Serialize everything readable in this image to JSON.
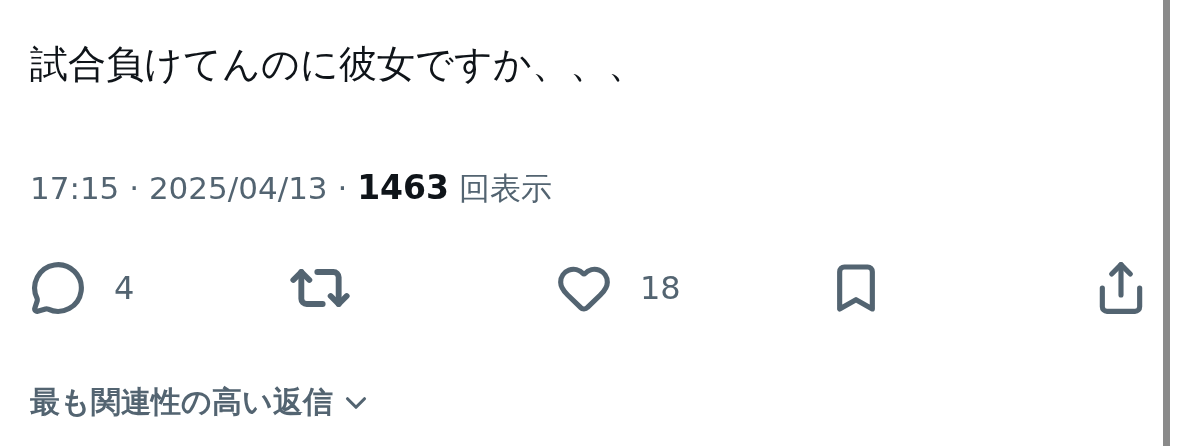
{
  "post": {
    "text": "試合負けてんのに彼女ですか、、、",
    "meta": "17:15 · 2025/04/13 · **1463** 回表示",
    "actions": [
      {
        "kind": "reply",
        "count": "4"
      },
      {
        "kind": "repost"
      },
      {
        "kind": "like",
        "count": "18"
      },
      {
        "kind": "bookmark"
      },
      {
        "kind": "share"
      }
    ]
  },
  "reply_sort": {
    "label": "最も関連性の高い返信"
  }
}
